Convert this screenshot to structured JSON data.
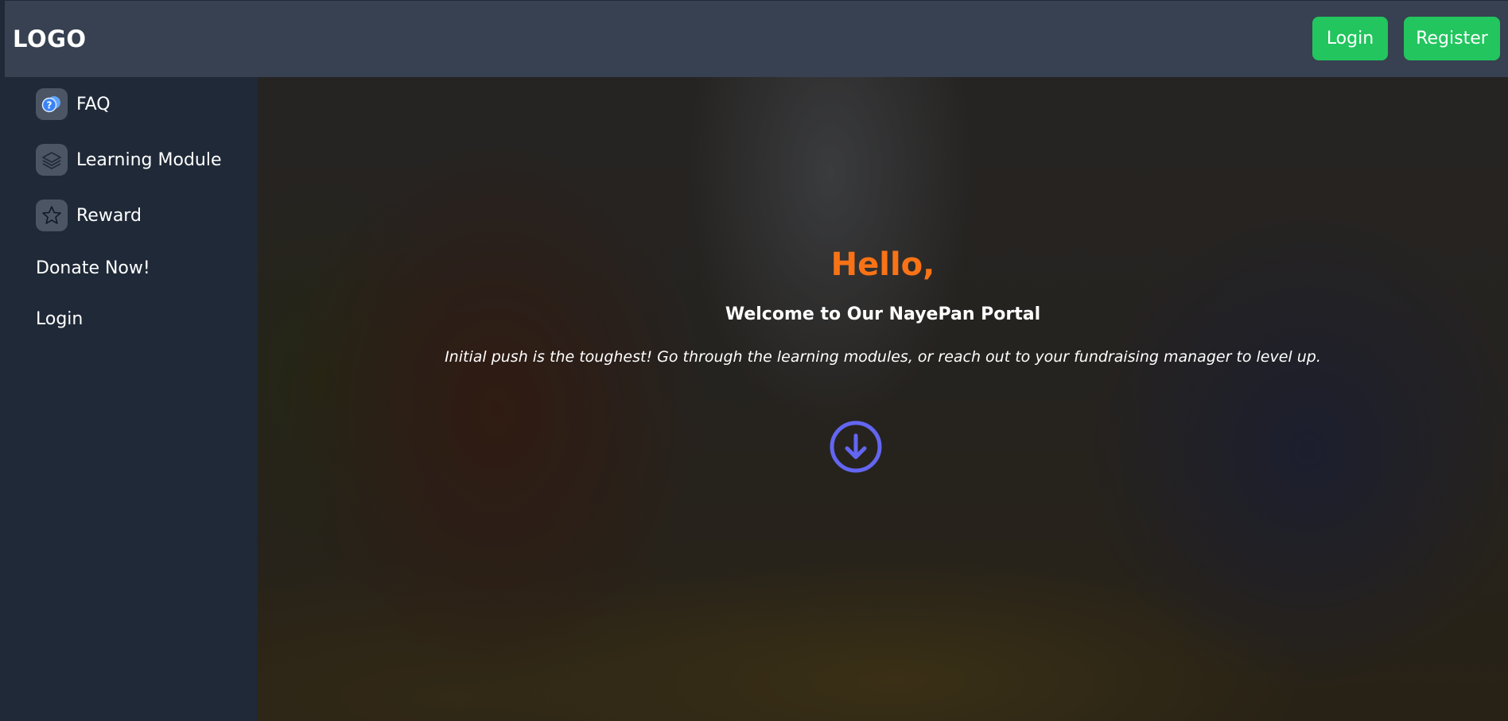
{
  "header": {
    "logo": "LOGO",
    "login_label": "Login",
    "register_label": "Register"
  },
  "sidebar": {
    "items": [
      {
        "label": "FAQ",
        "icon": "faq-icon"
      },
      {
        "label": "Learning Module",
        "icon": "layers-icon"
      },
      {
        "label": "Reward",
        "icon": "star-icon"
      },
      {
        "label": "Donate Now!"
      },
      {
        "label": "Login"
      }
    ]
  },
  "hero": {
    "greeting": "Hello,",
    "welcome": "Welcome to Our NayePan Portal",
    "tagline": "Initial push is the toughest! Go through the learning modules, or reach out to your fundraising manager to level up.",
    "scroll_icon": "arrow-down-circle-icon"
  },
  "colors": {
    "topbar": "#374151",
    "sidebar": "#1f2937",
    "button": "#22c55e",
    "greeting": "#f97316",
    "scroll_icon": "#6366f1"
  }
}
